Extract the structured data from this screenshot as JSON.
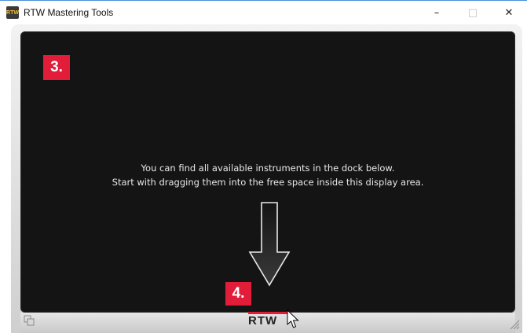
{
  "window": {
    "title": "RTW Mastering Tools",
    "app_icon_text": "RTW",
    "controls": {
      "minimize": "–",
      "maximize": "□",
      "close": "✕"
    }
  },
  "display": {
    "badge_top": "3.",
    "badge_bottom": "4.",
    "message_line1": "You can find all available instruments in the dock below.",
    "message_line2": "Start with dragging them into the free space inside this display area."
  },
  "dock": {
    "logo_text": "RTW",
    "left_icon": "windows-icon",
    "right_icon": "resize-grip-icon"
  },
  "colors": {
    "accent": "#e21d3a",
    "display_bg": "#141414",
    "frame_bg": "#e0e0e0"
  }
}
